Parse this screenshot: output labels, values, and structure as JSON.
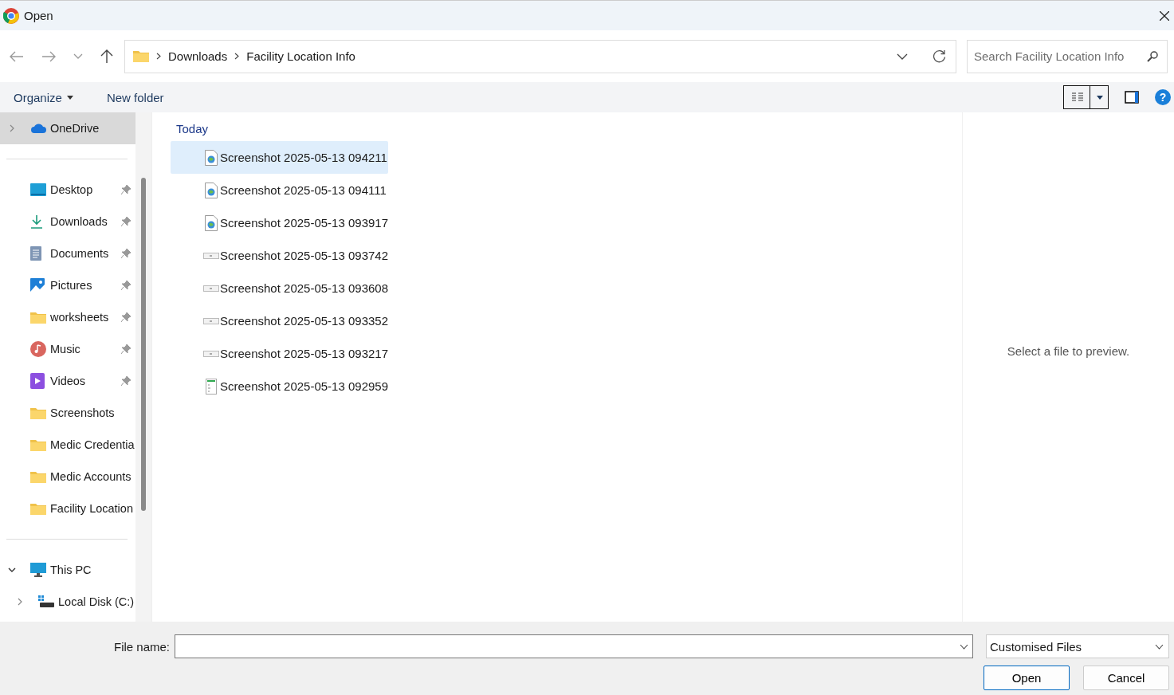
{
  "window": {
    "title": "Open"
  },
  "address_bar": {
    "path": [
      "Downloads",
      "Facility Location Info"
    ]
  },
  "search": {
    "placeholder": "Search Facility Location Info"
  },
  "toolbar": {
    "organize": "Organize",
    "new_folder": "New folder",
    "help": "?"
  },
  "sidebar": {
    "sections": [
      {
        "items": [
          {
            "label": "OneDrive",
            "kind": "cloud",
            "selected": true,
            "pinned": false,
            "expanded": false
          }
        ]
      },
      {
        "items": [
          {
            "label": "Desktop",
            "kind": "desktop",
            "selected": false,
            "pinned": true
          },
          {
            "label": "Downloads",
            "kind": "download",
            "selected": false,
            "pinned": true
          },
          {
            "label": "Documents",
            "kind": "document",
            "selected": false,
            "pinned": true
          },
          {
            "label": "Pictures",
            "kind": "pictures",
            "selected": false,
            "pinned": true
          },
          {
            "label": "worksheets",
            "kind": "folder",
            "selected": false,
            "pinned": true
          },
          {
            "label": "Music",
            "kind": "music",
            "selected": false,
            "pinned": true
          },
          {
            "label": "Videos",
            "kind": "videos",
            "selected": false,
            "pinned": true
          },
          {
            "label": "Screenshots",
            "kind": "folder",
            "selected": false,
            "pinned": false
          },
          {
            "label": "Medic Credentia",
            "kind": "folder",
            "selected": false,
            "pinned": false
          },
          {
            "label": "Medic Accounts",
            "kind": "folder",
            "selected": false,
            "pinned": false
          },
          {
            "label": "Facility Location",
            "kind": "folder",
            "selected": false,
            "pinned": false
          }
        ]
      },
      {
        "items": [
          {
            "label": "This PC",
            "kind": "pc",
            "selected": false,
            "pinned": false,
            "expanded": true,
            "children": [
              {
                "label": "Local Disk (C:)",
                "kind": "disk",
                "selected": false,
                "pinned": false,
                "expanded": false
              }
            ]
          }
        ]
      }
    ]
  },
  "files": {
    "group": "Today",
    "items": [
      {
        "name": "Screenshot 2025-05-13 094211",
        "kind": "image",
        "selected": true
      },
      {
        "name": "Screenshot 2025-05-13 094111",
        "kind": "image",
        "selected": false
      },
      {
        "name": "Screenshot 2025-05-13 093917",
        "kind": "image",
        "selected": false
      },
      {
        "name": "Screenshot 2025-05-13 093742",
        "kind": "thumbnail",
        "selected": false
      },
      {
        "name": "Screenshot 2025-05-13 093608",
        "kind": "thumbnail",
        "selected": false
      },
      {
        "name": "Screenshot 2025-05-13 093352",
        "kind": "thumbnail",
        "selected": false
      },
      {
        "name": "Screenshot 2025-05-13 093217",
        "kind": "thumbnail",
        "selected": false
      },
      {
        "name": "Screenshot 2025-05-13 092959",
        "kind": "sheet",
        "selected": false
      }
    ]
  },
  "preview": {
    "message": "Select a file to preview."
  },
  "footer": {
    "file_name_label": "File name:",
    "file_type": "Customised Files",
    "open": "Open",
    "cancel": "Cancel"
  }
}
